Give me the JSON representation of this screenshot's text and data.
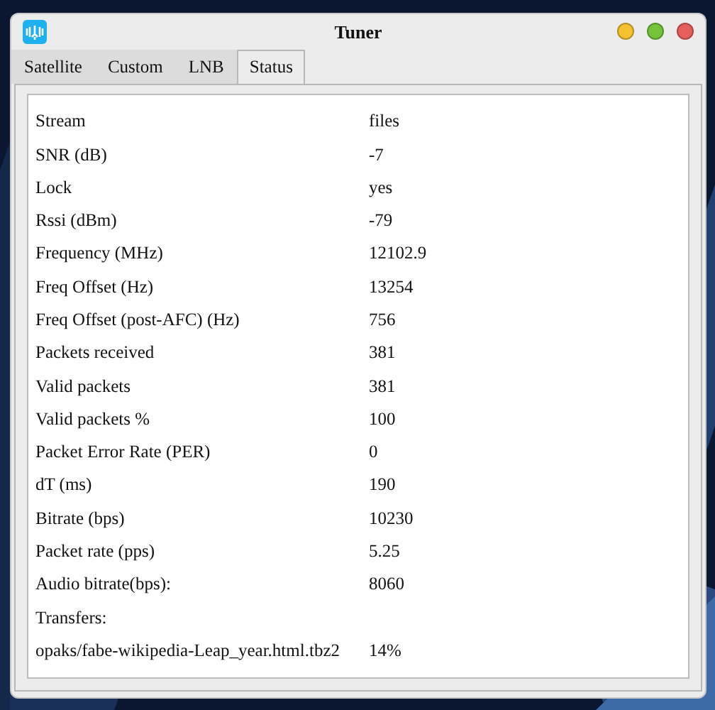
{
  "window": {
    "title": "Tuner"
  },
  "tabs": [
    {
      "label": "Satellite",
      "selected": false
    },
    {
      "label": "Custom",
      "selected": false
    },
    {
      "label": "LNB",
      "selected": false
    },
    {
      "label": "Status",
      "selected": true
    }
  ],
  "status_rows": [
    {
      "label": "Stream",
      "value": "files"
    },
    {
      "label": "SNR (dB)",
      "value": "-7"
    },
    {
      "label": "Lock",
      "value": "yes"
    },
    {
      "label": "Rssi (dBm)",
      "value": "-79"
    },
    {
      "label": "Frequency (MHz)",
      "value": "12102.9"
    },
    {
      "label": "Freq Offset (Hz)",
      "value": "13254"
    },
    {
      "label": "Freq Offset (post-AFC) (Hz)",
      "value": "756"
    },
    {
      "label": "Packets received",
      "value": "381"
    },
    {
      "label": "Valid packets",
      "value": "381"
    },
    {
      "label": "Valid packets %",
      "value": "100"
    },
    {
      "label": "Packet Error Rate (PER)",
      "value": "0"
    },
    {
      "label": "dT (ms)",
      "value": "190"
    },
    {
      "label": "Bitrate (bps)",
      "value": "10230"
    },
    {
      "label": "Packet rate (pps)",
      "value": "5.25"
    },
    {
      "label": "Audio bitrate(bps):",
      "value": "8060"
    },
    {
      "label": "Transfers:"
    },
    {
      "label": "opaks/fabe-wikipedia-Leap_year.html.tbz2",
      "value": "14%"
    }
  ]
}
